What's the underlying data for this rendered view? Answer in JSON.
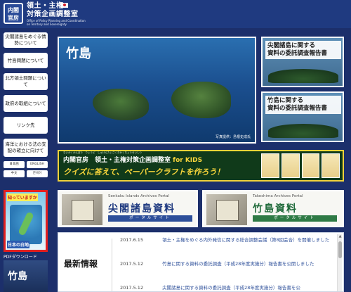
{
  "header": {
    "logo_line1": "内閣",
    "logo_line2": "官房",
    "title_line1": "領土・主権",
    "title_line2": "対策企画調整室",
    "subtitle_line1": "Office of Policy Planning and Coordination",
    "subtitle_line2": "on Territory and Sovereignty"
  },
  "sidebar": {
    "items": [
      {
        "label": "尖閣諸島をめぐる情勢について"
      },
      {
        "label": "竹島問題について"
      },
      {
        "label": "北方領土問題について"
      },
      {
        "label": "政府の取組について"
      },
      {
        "label": "リンク先"
      },
      {
        "label": "海洋における法の支配の確立に向けて"
      }
    ],
    "lang_buttons": [
      "日本語",
      "ENGLISH",
      "中文",
      "한국어"
    ],
    "quiz_top": "知っていますか",
    "quiz_bottom": "日本の白地",
    "pdf_label": "PDFダウンロード",
    "bottom_title": "竹島"
  },
  "hero": {
    "title": "竹島",
    "credit": "写真提供：島根史成氏"
  },
  "reports": [
    {
      "line1": "尖閣諸島に関する",
      "line2": "資料の委託調査報告書"
    },
    {
      "line1": "竹島に関する",
      "line2": "資料の委託調査報告書"
    }
  ],
  "kids": {
    "ruby": "ないかくかんぼう　りょうど　しゅけんたいさくきかくちょうせいしつ",
    "line1_pre": "内閣官房　領土・主権対策企画調整室",
    "line1_for": "for KIDS",
    "line2": "クイズに答えて、ペーパークラフトを作ろう！"
  },
  "portals": [
    {
      "en": "Senkaku Islands Archives Portal",
      "jp": "尖閣諸島資料",
      "bar": "ポータルサイト"
    },
    {
      "en": "Takeshima Archives Portal",
      "jp": "竹島資料",
      "bar": "ポータルサイト"
    }
  ],
  "news": {
    "heading": "最新情報",
    "items": [
      {
        "date": "2017.6.15",
        "text": "領土・主権をめぐる内外発信に関する総合調整会議（第8回会合）を開催しました"
      },
      {
        "date": "2017.5.12",
        "text": "竹島に関する資料の委託調査（平成28年度実施分）報告書を公開しました"
      },
      {
        "date": "2017.5.12",
        "text": "尖閣諸島に関する資料の委託調査（平成28年度実施分）報告書を公"
      }
    ]
  }
}
